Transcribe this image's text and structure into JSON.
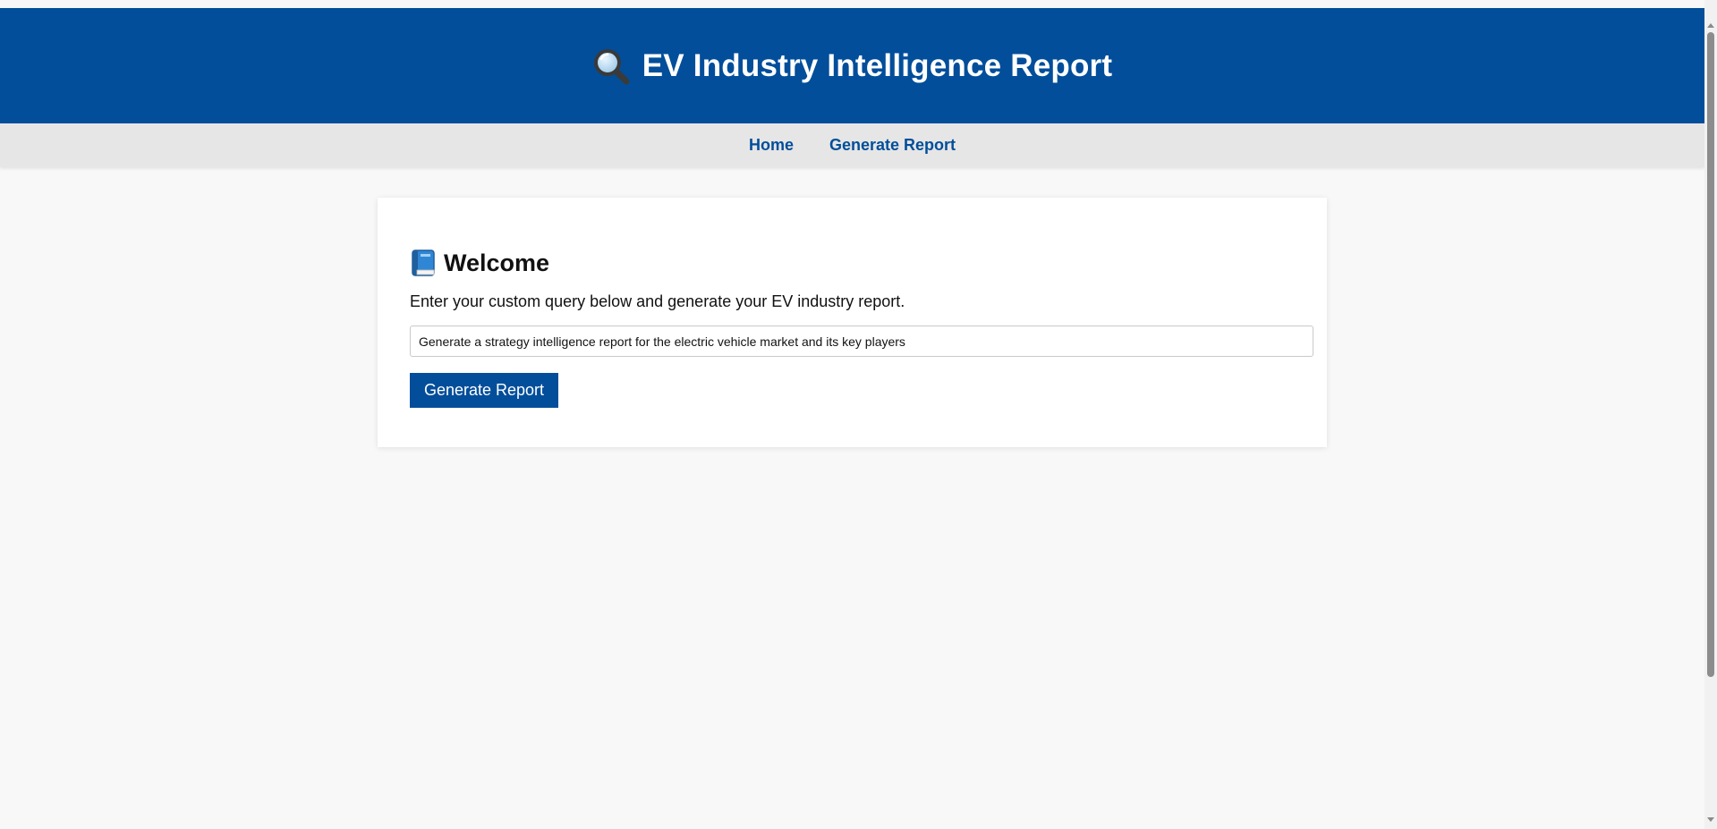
{
  "header": {
    "icon": "magnifier-icon",
    "title": "EV Industry Intelligence Report"
  },
  "nav": {
    "items": [
      {
        "label": "Home"
      },
      {
        "label": "Generate Report"
      }
    ]
  },
  "card": {
    "heading_icon": "book-icon",
    "heading": "Welcome",
    "description": "Enter your custom query below and generate your EV industry report.",
    "query_value": "Generate a strategy intelligence report for the electric vehicle market and its key players",
    "button_label": "Generate Report"
  },
  "colors": {
    "brand_blue": "#024e9a",
    "nav_background": "#e6e6e6",
    "page_background": "#f8f8f8"
  }
}
